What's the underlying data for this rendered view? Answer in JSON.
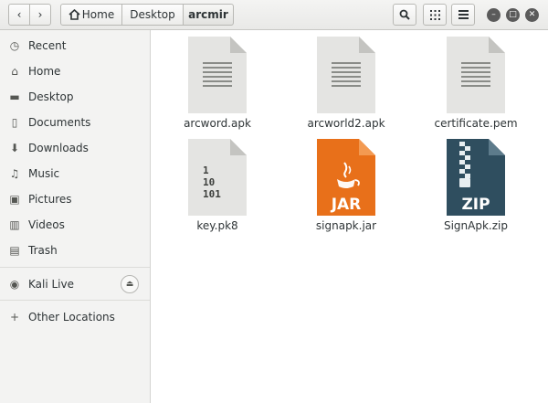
{
  "header": {
    "breadcrumbs": [
      {
        "label": "Home",
        "icon": "home-icon"
      },
      {
        "label": "Desktop"
      },
      {
        "label": "arcmir"
      }
    ],
    "buttons": [
      "back-icon",
      "forward-icon",
      "search-icon",
      "view-grid-icon",
      "menu-icon"
    ],
    "window_controls": [
      "minimize-icon",
      "maximize-icon",
      "close-icon"
    ]
  },
  "sidebar": {
    "items": [
      {
        "label": "Recent",
        "icon": "clock-icon"
      },
      {
        "label": "Home",
        "icon": "home-icon"
      },
      {
        "label": "Desktop",
        "icon": "folder-icon"
      },
      {
        "label": "Documents",
        "icon": "document-icon"
      },
      {
        "label": "Downloads",
        "icon": "download-icon"
      },
      {
        "label": "Music",
        "icon": "music-icon"
      },
      {
        "label": "Pictures",
        "icon": "pictures-icon"
      },
      {
        "label": "Videos",
        "icon": "video-icon"
      },
      {
        "label": "Trash",
        "icon": "trash-icon"
      }
    ],
    "devices": [
      {
        "label": "Kali Live",
        "icon": "disc-icon",
        "eject": "eject-icon"
      }
    ],
    "other": {
      "label": "Other Locations",
      "icon": "plus-icon"
    }
  },
  "files": [
    {
      "name": "arcword.apk",
      "type": "text"
    },
    {
      "name": "arcworld2.apk",
      "type": "text"
    },
    {
      "name": "certificate.pem",
      "type": "text"
    },
    {
      "name": "key.pk8",
      "type": "binary",
      "glyph_lines": [
        "1",
        "10",
        "101"
      ]
    },
    {
      "name": "signapk.jar",
      "type": "jar",
      "badge": "JAR"
    },
    {
      "name": "SignApk.zip",
      "type": "zip",
      "badge": "ZIP"
    }
  ],
  "colors": {
    "jar": "#e8701a",
    "zip": "#2f4e5f",
    "doc": "#e4e4e2"
  }
}
